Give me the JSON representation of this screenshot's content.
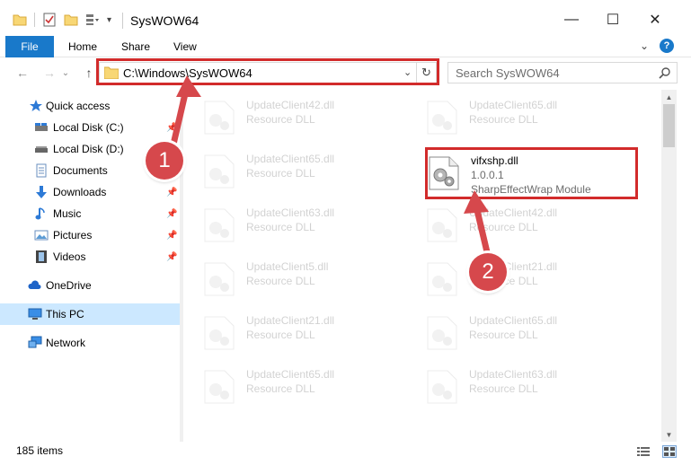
{
  "window": {
    "title": "SysWOW64",
    "minimize": "—",
    "maximize": "☐",
    "close": "✕"
  },
  "ribbon": {
    "file_tab": "File",
    "tabs": [
      "Home",
      "Share",
      "View"
    ],
    "expand": "⌄",
    "help": "?"
  },
  "nav": {
    "back": "←",
    "forward": "→",
    "recent": "⌄",
    "up": "↑",
    "address_path": "C:\\Windows\\SysWOW64",
    "address_dropdown": "⌄",
    "refresh": "↻",
    "search_placeholder": "Search SysWOW64"
  },
  "sidebar": {
    "items": [
      {
        "label": "Quick access",
        "icon": "star-icon",
        "pinned": false
      },
      {
        "label": "Local Disk (C:)",
        "icon": "drive-icon",
        "pinned": true
      },
      {
        "label": "Local Disk (D:)",
        "icon": "drive-icon",
        "pinned": false
      },
      {
        "label": "Documents",
        "icon": "document-icon",
        "pinned": true
      },
      {
        "label": "Downloads",
        "icon": "download-icon",
        "pinned": true
      },
      {
        "label": "Music",
        "icon": "music-icon",
        "pinned": true
      },
      {
        "label": "Pictures",
        "icon": "pictures-icon",
        "pinned": true
      },
      {
        "label": "Videos",
        "icon": "video-icon",
        "pinned": true
      },
      {
        "label": "OneDrive",
        "icon": "cloud-icon",
        "pinned": false
      },
      {
        "label": "This PC",
        "icon": "computer-icon",
        "pinned": false,
        "selected": true
      },
      {
        "label": "Network",
        "icon": "network-icon",
        "pinned": false
      }
    ],
    "pin_glyph": "📌"
  },
  "files": {
    "left_column": [
      {
        "name": "UpdateClient42.dll",
        "desc": "Resource DLL"
      },
      {
        "name": "UpdateClient65.dll",
        "desc": "Resource DLL"
      },
      {
        "name": "UpdateClient63.dll",
        "desc": "Resource DLL"
      },
      {
        "name": "UpdateClient5.dll",
        "desc": "Resource DLL"
      },
      {
        "name": "UpdateClient21.dll",
        "desc": "Resource DLL"
      },
      {
        "name": "UpdateClient65.dll",
        "desc": "Resource DLL"
      }
    ],
    "right_column": [
      {
        "name": "UpdateClient65.dll",
        "desc": "Resource DLL"
      },
      {
        "name": "vifxshp.dll",
        "desc": "1.0.0.1",
        "desc2": "SharpEffectWrap Module",
        "highlighted": true
      },
      {
        "name": "UpdateClient42.dll",
        "desc": "Resource DLL"
      },
      {
        "name": "UpdateClient21.dll",
        "desc": "Resource DLL"
      },
      {
        "name": "UpdateClient65.dll",
        "desc": "Resource DLL"
      },
      {
        "name": "UpdateClient63.dll",
        "desc": "Resource DLL"
      }
    ]
  },
  "status": {
    "item_count": "185 items"
  },
  "callouts": {
    "step1": "1",
    "step2": "2"
  },
  "colors": {
    "accent": "#1979ca",
    "highlight_border": "#d22b2b",
    "callout": "#d6484c",
    "selected_nav": "#cce8ff"
  }
}
